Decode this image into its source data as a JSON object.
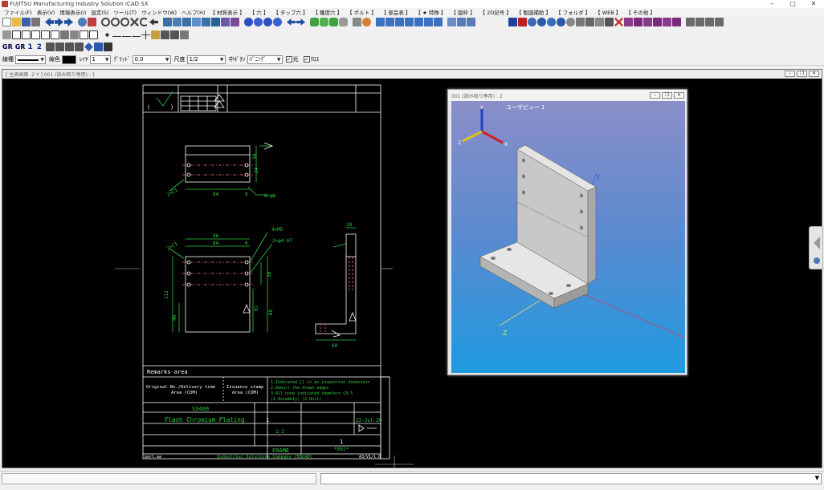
{
  "window": {
    "title": "FUJITSU Manufacturing Industry Solution iCAD SX"
  },
  "menu": [
    "ファイル(F)",
    "表示(V)",
    "情報表示(I)",
    "設定(S)",
    "ツール(T)",
    "ウィンドウ(W)",
    "ヘルプ(H)",
    "【 材質表示 】",
    "【 穴 】",
    "【 タップ穴 】",
    "【 穫度穴 】",
    "【 ボルト 】",
    "【 部品表 】",
    "【 ★ 特殊 】",
    "【 図枠 】",
    "【 2D記号 】",
    "【 製図補助 】",
    "【 フォルダ 】",
    "【 WEB 】",
    "【 その他 】"
  ],
  "toolbar3": {
    "gr_label1": "GR",
    "gr_label2": "GR",
    "num1": "1",
    "num2": "2"
  },
  "propbar": {
    "line_type_label": "線種",
    "line_color_label": "線色",
    "layer_label": "ﾚｲﾔ",
    "layer_value": "1",
    "grid_label": "ｸﾞﾘｯﾄﾞ",
    "grid_value": "0.0",
    "scale_label": "尺度",
    "scale_value": "1/2",
    "center_button_label": "中ﾎﾞﾀﾝ",
    "center_button_value": "ﾊﾟﾆﾝｸﾞ",
    "light_label": "光",
    "cross_label": "ｸﾛｽ"
  },
  "main_window": {
    "title": "[ 主表画面 -2 Y ]  001 (読み取り専用) : 1"
  },
  "drawing": {
    "remarks_label": "Remarks area",
    "original_no": "Original No./Delivery time",
    "original_area": "Area (COM)",
    "issuance_stamp": "Issuance stamp",
    "issuance_area": "Area (COM)",
    "note1": "1.Indicated [] is an inspection dimension",
    "note2": "2.Deburr the drawn edges",
    "note3": "3.All none indicated chamfers C0.5",
    "note4": "(1 Assembly) (2 Unit)",
    "material": "SS400",
    "finish": "Flash Chromium Plating",
    "qty": "1",
    "date": "22-Jul-20",
    "scale": "1:2",
    "name": "FRAME",
    "sheet": "1",
    "drawing_no": "*001*",
    "company": "Industrial Solutions Company (ENCAD)",
    "sheet_ref": "A3/V1/1.0",
    "paper": "part.aa",
    "dims": {
      "d30": "30",
      "d24": "24",
      "d84a": "84",
      "d8": "8",
      "d6x6": "6×φ6",
      "d96": "96",
      "d84b": "84",
      "d6": "6",
      "d4m5": "4×M5",
      "d2phi": "2×φ4 H7",
      "d38": "38",
      "d112": "112",
      "d91": "91",
      "d46": "46",
      "d68": "68",
      "d14": "14",
      "d60": "60",
      "chamfer1": "2×C1",
      "chamfer2": "2×C1"
    }
  },
  "view3d": {
    "window_title": "001 (読み取り専用) : 2",
    "label": "ユーザビュー 1",
    "axis_x": "X",
    "axis_y": "Y",
    "axis_z": "Z",
    "model_axis_y": "Y",
    "model_axis_z": "Z"
  }
}
